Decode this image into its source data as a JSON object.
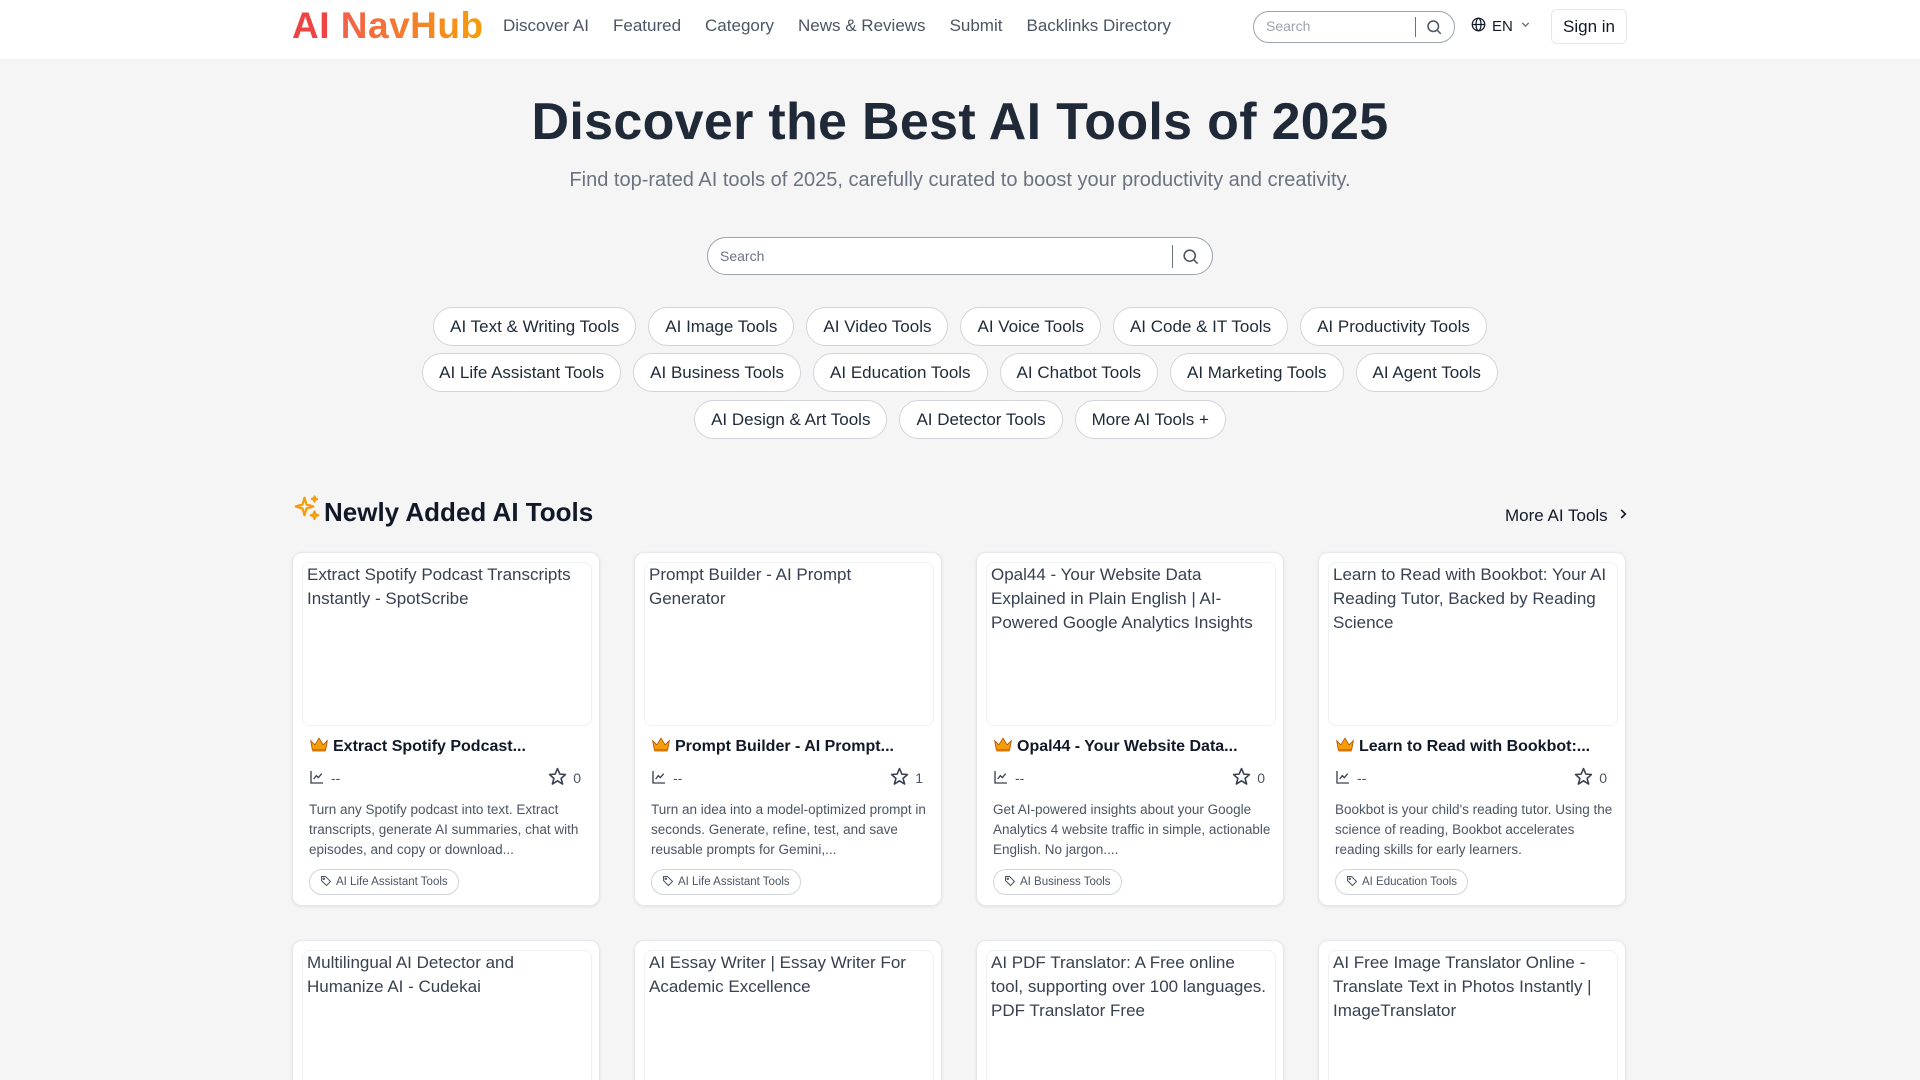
{
  "header": {
    "logo_ai": "AI",
    "logo_rest": " NavHub",
    "nav": [
      "Discover AI",
      "Featured",
      "Category",
      "News & Reviews",
      "Submit",
      "Backlinks Directory"
    ],
    "search_placeholder": "Search",
    "lang": "EN",
    "signin": "Sign in"
  },
  "hero": {
    "title": "Discover the Best AI Tools of 2025",
    "subtitle": "Find top-rated AI tools of 2025, carefully curated to boost your productivity and creativity.",
    "search_placeholder": "Search"
  },
  "categories": {
    "row1": [
      "AI Text & Writing Tools",
      "AI Image Tools",
      "AI Video Tools",
      "AI Voice Tools",
      "AI Code & IT Tools",
      "AI Productivity Tools"
    ],
    "row2": [
      "AI Life Assistant Tools",
      "AI Business Tools",
      "AI Education Tools",
      "AI Chatbot Tools",
      "AI Marketing Tools",
      "AI Agent Tools"
    ],
    "row3": [
      "AI Design & Art Tools",
      "AI Detector Tools",
      "More AI Tools +"
    ]
  },
  "section": {
    "title": "Newly Added AI Tools",
    "more": "More AI Tools"
  },
  "cards": [
    {
      "image_alt": "Extract Spotify Podcast Transcripts Instantly - SpotScribe",
      "name": "Extract Spotify Podcast...",
      "traffic": "--",
      "stars": "0",
      "desc": "Turn any Spotify podcast into text. Extract transcripts, generate AI summaries, chat with episodes, and copy or download...",
      "tag": "AI Life Assistant Tools"
    },
    {
      "image_alt": "Prompt Builder - AI Prompt Generator",
      "name": "Prompt Builder - AI Prompt...",
      "traffic": "--",
      "stars": "1",
      "desc": "Turn an idea into a model-optimized prompt in seconds. Generate, refine, test, and save reusable prompts for Gemini,...",
      "tag": "AI Life Assistant Tools"
    },
    {
      "image_alt": "Opal44 - Your Website Data Explained in Plain English | AI-Powered Google Analytics Insights",
      "name": "Opal44 - Your Website Data...",
      "traffic": "--",
      "stars": "0",
      "desc": "Get AI-powered insights about your Google Analytics 4 website traffic in simple, actionable English. No jargon....",
      "tag": "AI Business Tools"
    },
    {
      "image_alt": "Learn to Read with Bookbot: Your AI Reading Tutor, Backed by Reading Science",
      "name": "Learn to Read with Bookbot:...",
      "traffic": "--",
      "stars": "0",
      "desc": "Bookbot is your child's reading tutor. Using the science of reading, Bookbot accelerates reading skills for early learners.",
      "tag": "AI Education Tools"
    },
    {
      "image_alt": "Multilingual AI Detector and Humanize AI - Cudekai"
    },
    {
      "image_alt": "AI Essay Writer | Essay Writer For Academic Excellence"
    },
    {
      "image_alt": "AI PDF Translator: A Free online tool, supporting over 100 languages. PDF Translator Free"
    },
    {
      "image_alt": "AI Free Image Translator Online - Translate Text in Photos Instantly | ImageTranslator"
    }
  ],
  "colors": {
    "logo_red": "#ef4444",
    "logo_orange": "#f59e0b",
    "crown": "#f59e0b"
  }
}
